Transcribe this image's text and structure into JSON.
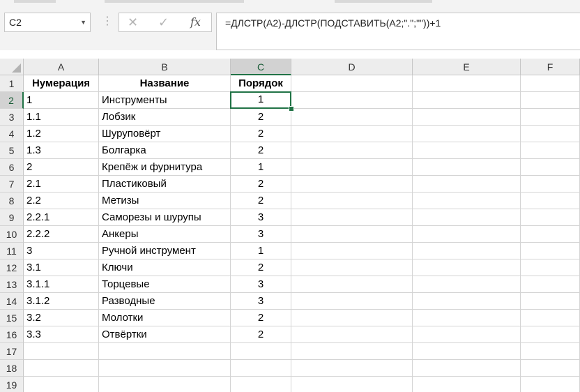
{
  "name_box": {
    "value": "C2"
  },
  "formula_bar": {
    "cancel_icon": "close-icon",
    "enter_icon": "check-icon",
    "function_label": "fx",
    "formula": "=ДЛСТР(A2)-ДЛСТР(ПОДСТАВИТЬ(A2;\".\";\"\"))+1"
  },
  "accent_color": "#217346",
  "columns": [
    "A",
    "B",
    "C",
    "D",
    "E",
    "F"
  ],
  "selected_column": "C",
  "selected_row": "2",
  "row_numbers": [
    "1",
    "2",
    "3",
    "4",
    "5",
    "6",
    "7",
    "8",
    "9",
    "10",
    "11",
    "12",
    "13",
    "14",
    "15",
    "16",
    "17",
    "18",
    "19"
  ],
  "header_row": {
    "a": "Нумерация",
    "b": "Название",
    "c": "Порядок"
  },
  "rows": [
    {
      "a": "1",
      "b": "Инструменты",
      "c": "1"
    },
    {
      "a": "1.1",
      "b": "Лобзик",
      "c": "2"
    },
    {
      "a": "1.2",
      "b": "Шуруповёрт",
      "c": "2"
    },
    {
      "a": "1.3",
      "b": "Болгарка",
      "c": "2"
    },
    {
      "a": "2",
      "b": "Крепёж и фурнитура",
      "c": "1"
    },
    {
      "a": "2.1",
      "b": "Пластиковый",
      "c": "2"
    },
    {
      "a": "2.2",
      "b": "Метизы",
      "c": "2"
    },
    {
      "a": "2.2.1",
      "b": "Саморезы и шурупы",
      "c": "3"
    },
    {
      "a": "2.2.2",
      "b": "Анкеры",
      "c": "3"
    },
    {
      "a": "3",
      "b": "Ручной инструмент",
      "c": "1"
    },
    {
      "a": "3.1",
      "b": "Ключи",
      "c": "2"
    },
    {
      "a": "3.1.1",
      "b": "Торцевые",
      "c": "3"
    },
    {
      "a": "3.1.2",
      "b": "Разводные",
      "c": "3"
    },
    {
      "a": "3.2",
      "b": "Молотки",
      "c": "2"
    },
    {
      "a": "3.3",
      "b": "Отвёртки",
      "c": "2"
    }
  ]
}
